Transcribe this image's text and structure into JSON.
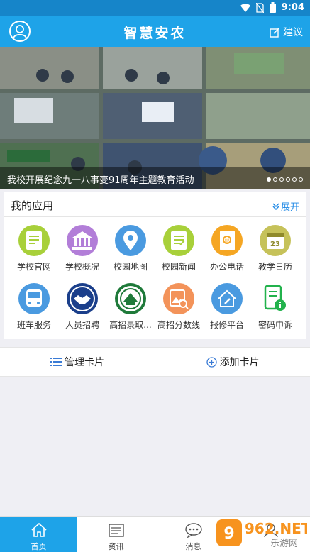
{
  "status": {
    "time": "9:04"
  },
  "header": {
    "title": "智慧安农",
    "suggest_label": "建议"
  },
  "banner": {
    "caption": "我校开展纪念九一八事变91周年主题教育活动",
    "dot_count": 6,
    "active_dot": 0
  },
  "apps": {
    "title": "我的应用",
    "expand_label": "展开",
    "items": [
      {
        "label": "学校官网",
        "icon": "document-icon",
        "color": "#a8d03a"
      },
      {
        "label": "学校概况",
        "icon": "building-icon",
        "color": "#b27ed8"
      },
      {
        "label": "校园地图",
        "icon": "map-pin-icon",
        "color": "#4a9ae0"
      },
      {
        "label": "校园新闻",
        "icon": "news-icon",
        "color": "#a8d03a"
      },
      {
        "label": "办公电话",
        "icon": "phone-book-icon",
        "color": "#f5a623"
      },
      {
        "label": "教学日历",
        "icon": "calendar-icon",
        "color": "#c6c25a"
      },
      {
        "label": "班车服务",
        "icon": "bus-icon",
        "color": "#4a9ae0"
      },
      {
        "label": "人员招聘",
        "icon": "handshake-icon",
        "color": "#1b3f8b"
      },
      {
        "label": "高招录取...",
        "icon": "school-seal-icon",
        "color": "#1f7a3a"
      },
      {
        "label": "高招分数线",
        "icon": "image-search-icon",
        "color": "#f3935a"
      },
      {
        "label": "报修平台",
        "icon": "house-wrench-icon",
        "color": "#4a9ae0"
      },
      {
        "label": "密码申诉",
        "icon": "info-doc-icon",
        "color": "#22b24c"
      }
    ]
  },
  "cards": {
    "manage_label": "管理卡片",
    "add_label": "添加卡片"
  },
  "tabs": [
    {
      "label": "首页",
      "icon": "home-icon"
    },
    {
      "label": "资讯",
      "icon": "news-icon"
    },
    {
      "label": "消息",
      "icon": "chat-icon"
    },
    {
      "label": "",
      "icon": "profile-icon"
    }
  ],
  "watermark": {
    "text": "962.NET",
    "sub": "乐游网"
  }
}
